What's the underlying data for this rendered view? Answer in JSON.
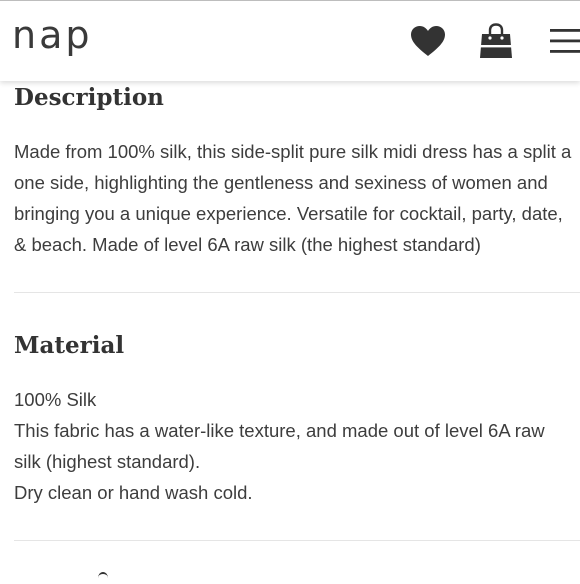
{
  "header": {
    "logo": "nap",
    "icons": [
      "heart-icon",
      "shopping-bag-icon",
      "hamburger-menu-icon"
    ],
    "accent": "#333333"
  },
  "description": {
    "title": "Description",
    "lines": [
      "Made from 100% silk, this side-split pure silk midi dress has a split a",
      "one side, highlighting the gentleness and sexiness of women and",
      "bringing you a unique experience. Versatile for cocktail, party, date,",
      "& beach. Made of level 6A raw silk (the highest standard)"
    ]
  },
  "material": {
    "title": "Material",
    "lines": [
      "100% Silk",
      "This fabric has a water-like texture, and made out of level 6A raw",
      "silk (highest standard).",
      "Dry clean or hand wash cold."
    ]
  }
}
